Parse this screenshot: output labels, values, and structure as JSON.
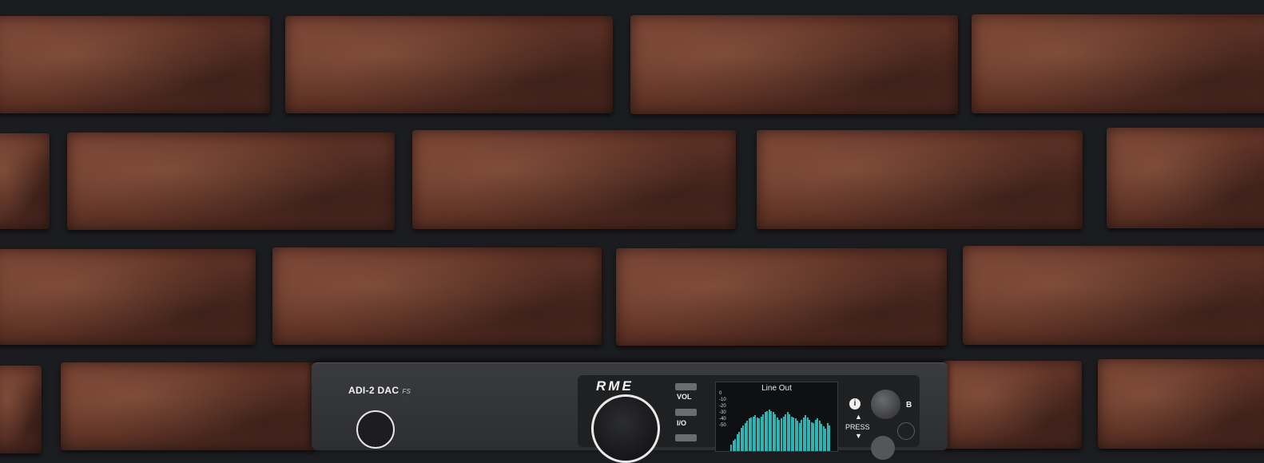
{
  "device": {
    "model": "ADI-2 DAC",
    "model_suffix": "FS",
    "brand": "RME",
    "buttons": [
      "VOL",
      "I/O"
    ],
    "display": {
      "title": "Line Out",
      "ticks": [
        "0",
        "-10",
        "-20",
        "-30",
        "-40",
        "-50"
      ],
      "meter_levels": [
        0.12,
        0.18,
        0.22,
        0.3,
        0.35,
        0.42,
        0.46,
        0.5,
        0.55,
        0.58,
        0.6,
        0.62,
        0.64,
        0.6,
        0.58,
        0.62,
        0.66,
        0.7,
        0.72,
        0.74,
        0.72,
        0.7,
        0.66,
        0.6,
        0.56,
        0.58,
        0.62,
        0.66,
        0.7,
        0.66,
        0.62,
        0.6,
        0.58,
        0.54,
        0.5,
        0.56,
        0.6,
        0.64,
        0.6,
        0.56,
        0.52,
        0.5,
        0.56,
        0.58,
        0.54,
        0.48,
        0.44,
        0.4,
        0.5,
        0.46
      ]
    },
    "info_icon": "info-icon",
    "press_label": "PRESS",
    "b_label": "B"
  },
  "colors": {
    "meter": "#2fb3b3",
    "wall_mortar": "#1b1c1f",
    "brick": "#5e3226"
  }
}
